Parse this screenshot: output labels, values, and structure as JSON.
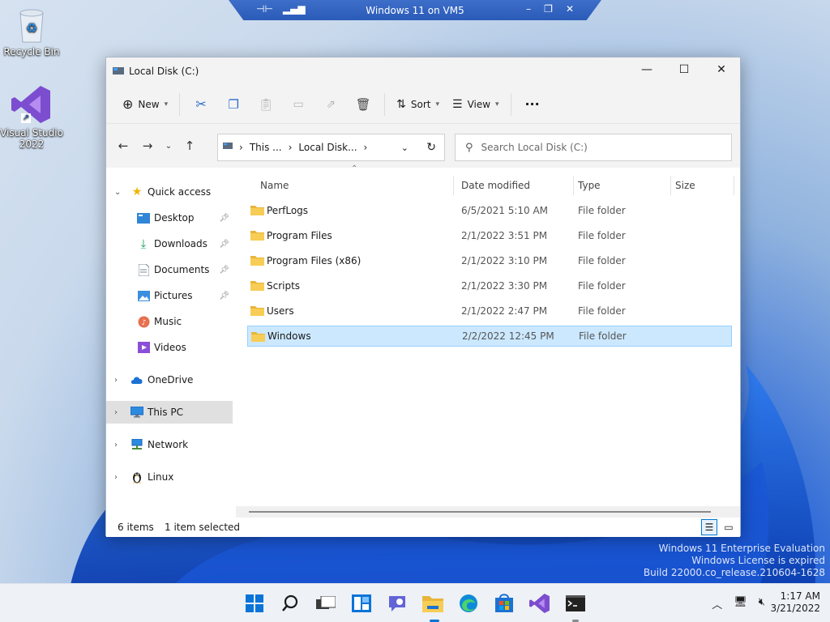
{
  "vm_bar": {
    "title": "Windows 11 on VM5"
  },
  "desktop": {
    "icons": [
      {
        "label": "Recycle Bin"
      },
      {
        "label_line1": "Visual Studio",
        "label_line2": "2022"
      }
    ]
  },
  "window": {
    "title": "Local Disk (C:)",
    "commands": {
      "new": "New",
      "sort": "Sort",
      "view": "View",
      "more": "···"
    },
    "address": {
      "crumb1": "This ...",
      "crumb2": "Local Disk...",
      "separator": "›"
    },
    "search": {
      "placeholder": "Search Local Disk (C:)"
    },
    "nav": {
      "quick_access": "Quick access",
      "desktop": "Desktop",
      "downloads": "Downloads",
      "documents": "Documents",
      "pictures": "Pictures",
      "music": "Music",
      "videos": "Videos",
      "onedrive": "OneDrive",
      "this_pc": "This PC",
      "network": "Network",
      "linux": "Linux"
    },
    "columns": {
      "name": "Name",
      "date": "Date modified",
      "type": "Type",
      "size": "Size"
    },
    "files": [
      {
        "name": "PerfLogs",
        "date": "6/5/2021 5:10 AM",
        "type": "File folder"
      },
      {
        "name": "Program Files",
        "date": "2/1/2022 3:51 PM",
        "type": "File folder"
      },
      {
        "name": "Program Files (x86)",
        "date": "2/1/2022 3:10 PM",
        "type": "File folder"
      },
      {
        "name": "Scripts",
        "date": "2/1/2022 3:30 PM",
        "type": "File folder"
      },
      {
        "name": "Users",
        "date": "2/1/2022 2:47 PM",
        "type": "File folder"
      },
      {
        "name": "Windows",
        "date": "2/2/2022 12:45 PM",
        "type": "File folder"
      }
    ],
    "status": {
      "count": "6 items",
      "selected": "1 item selected"
    }
  },
  "watermark": {
    "line1": "Windows 11 Enterprise Evaluation",
    "line2": "Windows License is expired",
    "line3": "Build 22000.co_release.210604-1628"
  },
  "taskbar": {
    "time": "1:17 AM",
    "date": "3/21/2022"
  },
  "colors": {
    "accent": "#0078d4",
    "selection": "#cce8ff",
    "folder": "#f5c542"
  }
}
